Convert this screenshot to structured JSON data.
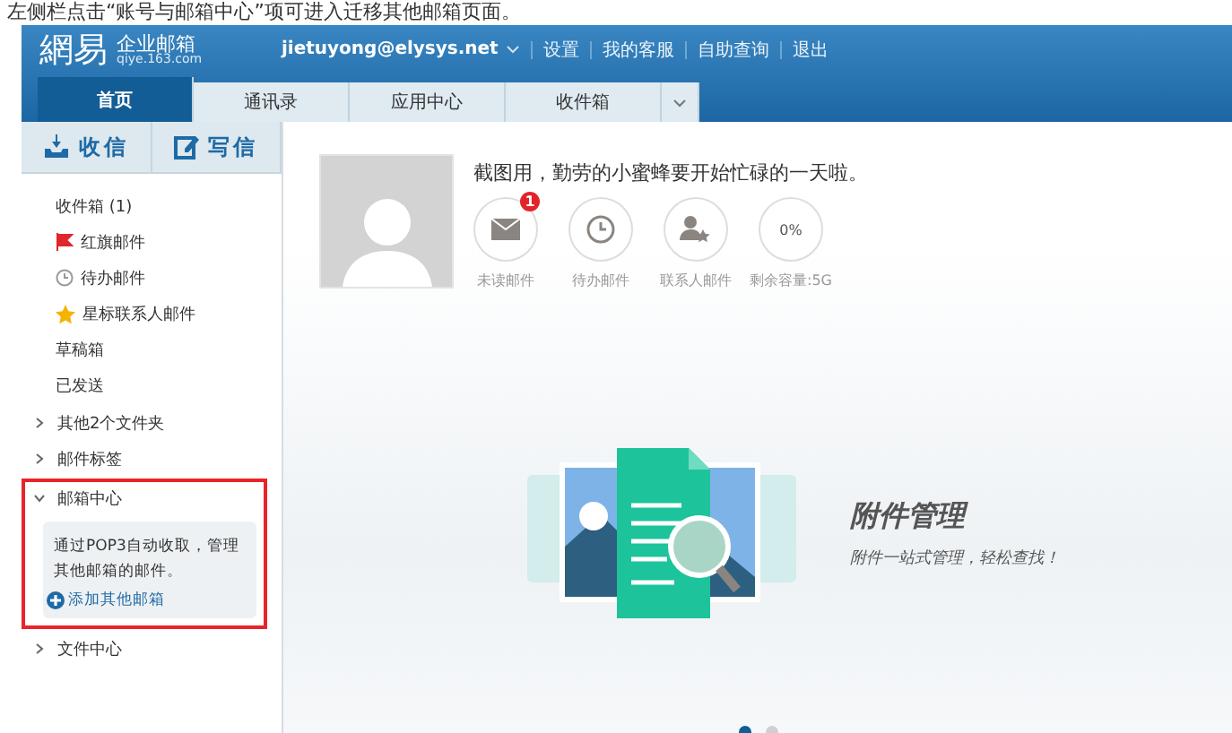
{
  "caption": "左侧栏点击“账号与邮箱中心”项可进入迁移其他邮箱页面。",
  "header": {
    "logo_main": "網易",
    "logo_name": "企业邮箱",
    "logo_domain": "qiye.163.com",
    "account": "jietuyong@elysys.net",
    "links": [
      "设置",
      "我的客服",
      "自助查询",
      "退出"
    ]
  },
  "tabs": [
    {
      "label": "首页",
      "selected": true
    },
    {
      "label": "通讯录",
      "selected": false
    },
    {
      "label": "应用中心",
      "selected": false
    },
    {
      "label": "收件箱",
      "selected": false
    }
  ],
  "sidebar": {
    "actions": [
      {
        "kind": "receive",
        "label": "收信"
      },
      {
        "kind": "compose",
        "label": "写信"
      }
    ],
    "items": [
      {
        "kind": "plain",
        "label": "收件箱 (1)"
      },
      {
        "kind": "flagged",
        "label": "红旗邮件"
      },
      {
        "kind": "todo",
        "label": "待办邮件"
      },
      {
        "kind": "starred",
        "label": "星标联系人邮件"
      },
      {
        "kind": "plain",
        "label": "草稿箱"
      },
      {
        "kind": "plain",
        "label": "已发送"
      },
      {
        "kind": "group",
        "expanded": false,
        "highlighted": false,
        "label": "其他2个文件夹"
      },
      {
        "kind": "group",
        "expanded": false,
        "highlighted": false,
        "label": "邮件标签"
      },
      {
        "kind": "group",
        "expanded": true,
        "highlighted": true,
        "label": "邮箱中心",
        "description": "通过POP3自动收取，管理其他邮箱的邮件。",
        "link": "添加其他邮箱"
      },
      {
        "kind": "group",
        "expanded": false,
        "highlighted": false,
        "label": "文件中心"
      }
    ]
  },
  "profile": {
    "greeting": "截图用，勤劳的小蜜蜂要开始忙碌的一天啦。",
    "stats": [
      {
        "kind": "mail",
        "badge": "1",
        "label": "未读邮件"
      },
      {
        "kind": "clock",
        "label": "待办邮件"
      },
      {
        "kind": "contact",
        "label": "联系人邮件"
      },
      {
        "kind": "text",
        "value": "0%",
        "label": "剩余容量:5G"
      }
    ]
  },
  "banner": {
    "title": "附件管理",
    "subtitle": "附件一站式管理，轻松查找！",
    "dots": [
      {
        "selected": true
      },
      {
        "selected": false
      }
    ]
  }
}
